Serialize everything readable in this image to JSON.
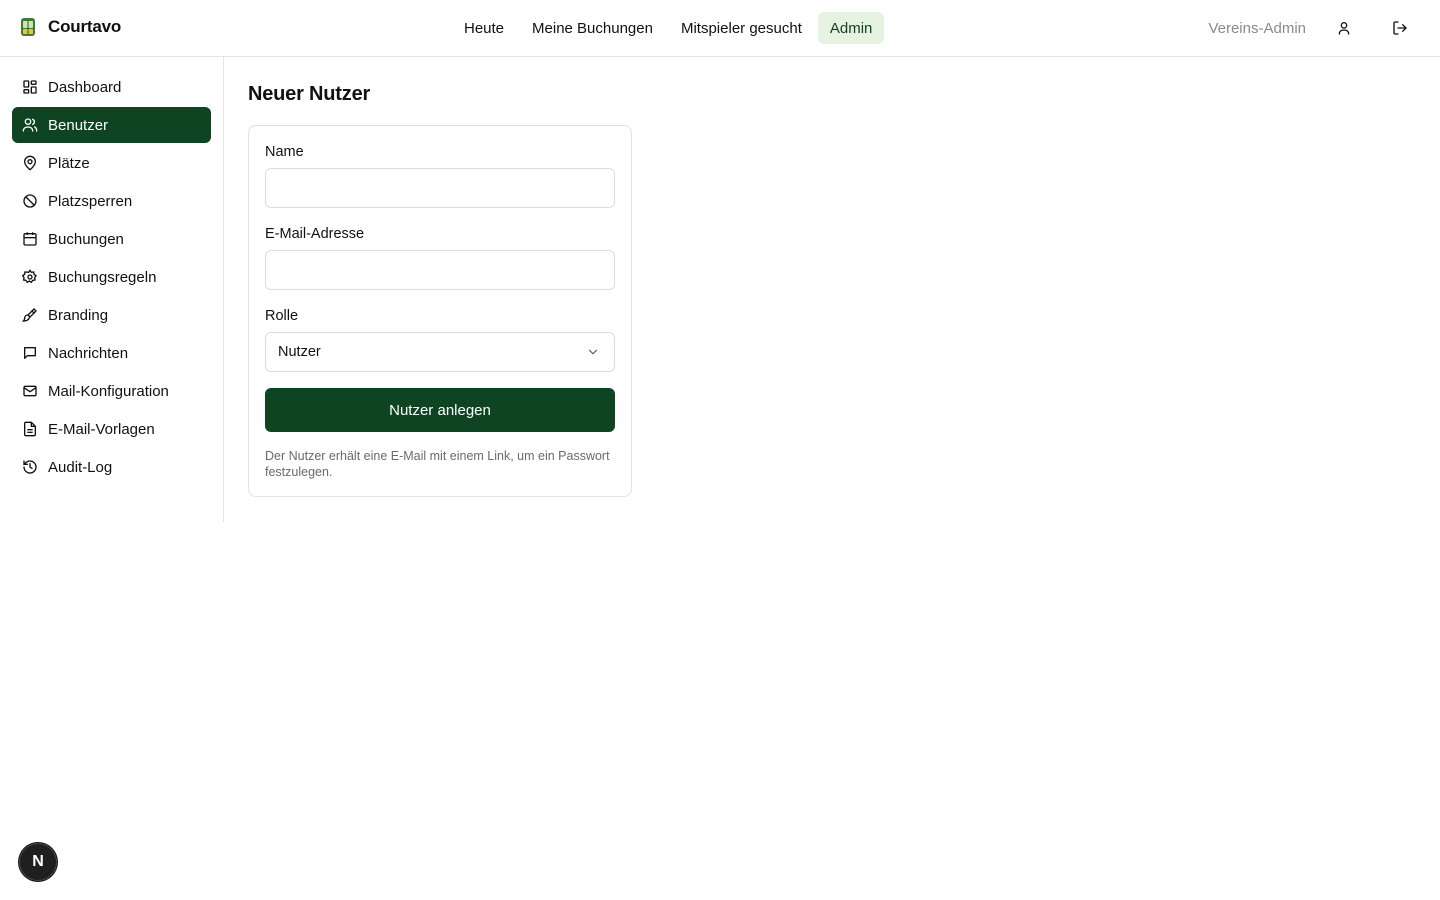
{
  "brand": {
    "name": "Courtavo"
  },
  "colors": {
    "primary": "#0f4423",
    "nav_active_bg": "#e6f3e2",
    "muted_text": "#8a8a8a"
  },
  "topnav": {
    "items": [
      {
        "label": "Heute",
        "active": false
      },
      {
        "label": "Meine Buchungen",
        "active": false
      },
      {
        "label": "Mitspieler gesucht",
        "active": false
      },
      {
        "label": "Admin",
        "active": true
      }
    ]
  },
  "header": {
    "role_label": "Vereins-Admin",
    "profile_icon": "user-icon",
    "logout_icon": "logout-icon"
  },
  "sidebar": {
    "items": [
      {
        "label": "Dashboard",
        "icon": "dashboard-icon",
        "active": false
      },
      {
        "label": "Benutzer",
        "icon": "users-icon",
        "active": true
      },
      {
        "label": "Plätze",
        "icon": "map-pin-icon",
        "active": false
      },
      {
        "label": "Platzsperren",
        "icon": "ban-icon",
        "active": false
      },
      {
        "label": "Buchungen",
        "icon": "calendar-icon",
        "active": false
      },
      {
        "label": "Buchungsregeln",
        "icon": "gear-icon",
        "active": false
      },
      {
        "label": "Branding",
        "icon": "paintbrush-icon",
        "active": false
      },
      {
        "label": "Nachrichten",
        "icon": "message-icon",
        "active": false
      },
      {
        "label": "Mail-Konfiguration",
        "icon": "mail-icon",
        "active": false
      },
      {
        "label": "E-Mail-Vorlagen",
        "icon": "file-text-icon",
        "active": false
      },
      {
        "label": "Audit-Log",
        "icon": "history-icon",
        "active": false
      }
    ]
  },
  "main": {
    "title": "Neuer Nutzer",
    "form": {
      "name_label": "Name",
      "name_value": "",
      "email_label": "E-Mail-Adresse",
      "email_value": "",
      "role_label": "Rolle",
      "role_value": "Nutzer",
      "submit_label": "Nutzer anlegen",
      "hint": "Der Nutzer erhält eine E-Mail mit einem Link, um ein Passwort festzulegen."
    }
  },
  "floating_badge": {
    "label": "N"
  }
}
